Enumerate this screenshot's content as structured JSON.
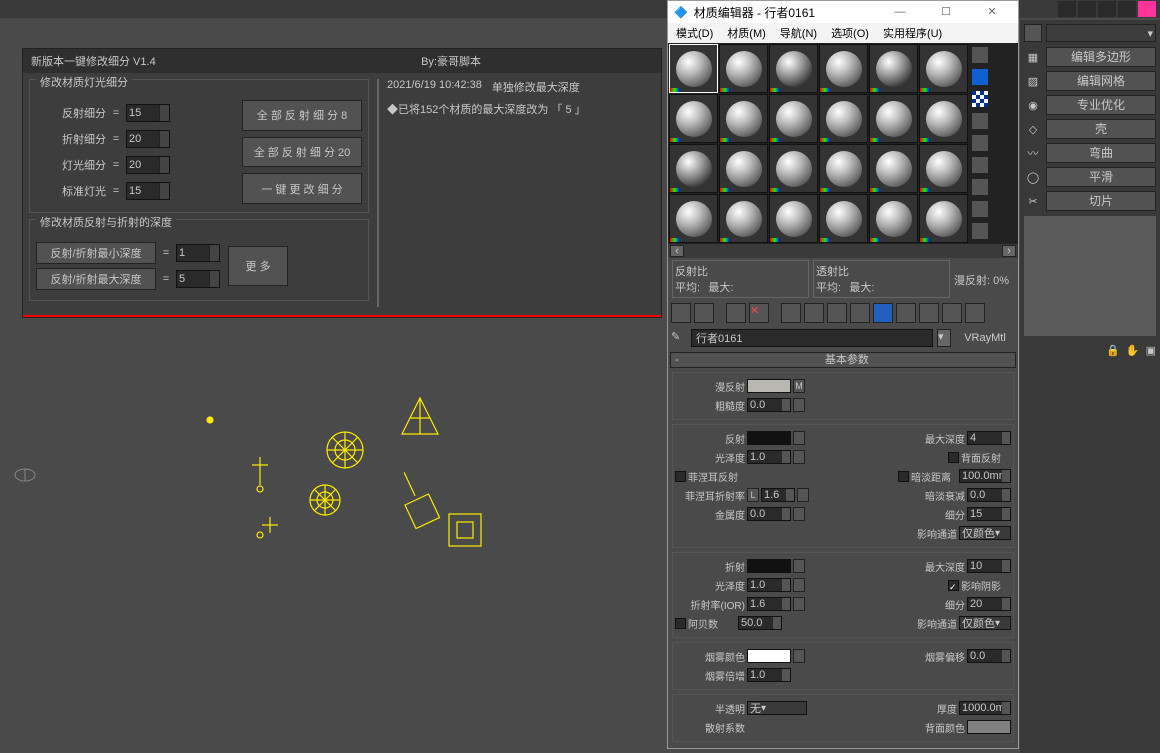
{
  "topbar_icons": [
    "tool1",
    "tool2",
    "tool3",
    "tool4",
    "tool5",
    "tool6",
    "tool7",
    "tool8"
  ],
  "right_panel": {
    "buttons": [
      "编辑多边形",
      "编辑网格",
      "专业优化",
      "壳",
      "弯曲",
      "平滑",
      "切片"
    ],
    "side_icons": [
      "grid",
      "checker",
      "sphere",
      "layers",
      "brush",
      "config",
      "tool-a",
      "tool-b"
    ]
  },
  "script": {
    "title_left": "新版本一键修改细分 V1.4",
    "title_right": "By:豪哥脚本",
    "group1": "修改材质灯光细分",
    "rows": [
      {
        "label": "反射细分",
        "val": "15"
      },
      {
        "label": "折射细分",
        "val": "20"
      },
      {
        "label": "灯光细分",
        "val": "20"
      },
      {
        "label": "标准灯光",
        "val": "15"
      }
    ],
    "btn_refl_all": "全 部 反 射 细 分 8",
    "btn_refl_all20": "全 部 反 射 细 分 20",
    "btn_onekey": "一 键 更 改 细 分",
    "group2": "修改材质反射与折射的深度",
    "depth_min_label": "反射/折射最小深度",
    "depth_min": "1",
    "depth_max_label": "反射/折射最大深度",
    "depth_max": "5",
    "more": "更 多",
    "log_time": "2021/6/19 10:42:38",
    "log_title": "单独修改最大深度",
    "log_line": "◆已将152个材质的最大深度改为 「 5 」"
  },
  "mat": {
    "title": "材质编辑器 - 行者0161",
    "menu": [
      "模式(D)",
      "材质(M)",
      "导航(N)",
      "选项(O)",
      "实用程序(U)"
    ],
    "stats": {
      "refl_label": "反射比",
      "trans_label": "透射比",
      "avg": "平均:",
      "max": "最大:",
      "diffuse": "漫反射:",
      "pct": "0%"
    },
    "name": "行者0161",
    "type": "VRayMtl",
    "rollout": "基本参数",
    "diffuse": {
      "label": "漫反射",
      "m": "M",
      "rough": "粗糙度",
      "rough_val": "0.0"
    },
    "refl": {
      "label": "反射",
      "gloss": "光泽度",
      "gloss_val": "1.0",
      "fresnel": "菲涅耳反射",
      "fresnel_ior": "菲涅耳折射率",
      "fresnel_l": "L",
      "fresnel_val": "1.6",
      "metal": "金属度",
      "metal_val": "0.0",
      "maxdepth": "最大深度",
      "maxdepth_val": "4",
      "backface": "背面反射",
      "dimdist": "暗淡距离",
      "dimdist_val": "100.0mm",
      "dimfall": "暗淡衰减",
      "dimfall_val": "0.0",
      "subdiv": "细分",
      "subdiv_val": "15",
      "channel": "影响通道",
      "channel_val": "仅颜色"
    },
    "refr": {
      "label": "折射",
      "gloss": "光泽度",
      "gloss_val": "1.0",
      "ior": "折射率(IOR)",
      "ior_val": "1.6",
      "abbe": "阿贝数",
      "abbe_val": "50.0",
      "maxdepth": "最大深度",
      "maxdepth_val": "10",
      "shadow": "影响阴影",
      "subdiv": "细分",
      "subdiv_val": "20",
      "channel": "影响通道",
      "channel_val": "仅颜色"
    },
    "fog": {
      "color": "烟雾颜色",
      "bias": "烟雾偏移",
      "bias_val": "0.0",
      "mult": "烟雾倍增",
      "mult_val": "1.0"
    },
    "trans": {
      "label": "半透明",
      "none": "无",
      "thick": "厚度",
      "thick_val": "1000.0m",
      "scatter": "散射系数",
      "backcolor": "背面颜色"
    }
  }
}
